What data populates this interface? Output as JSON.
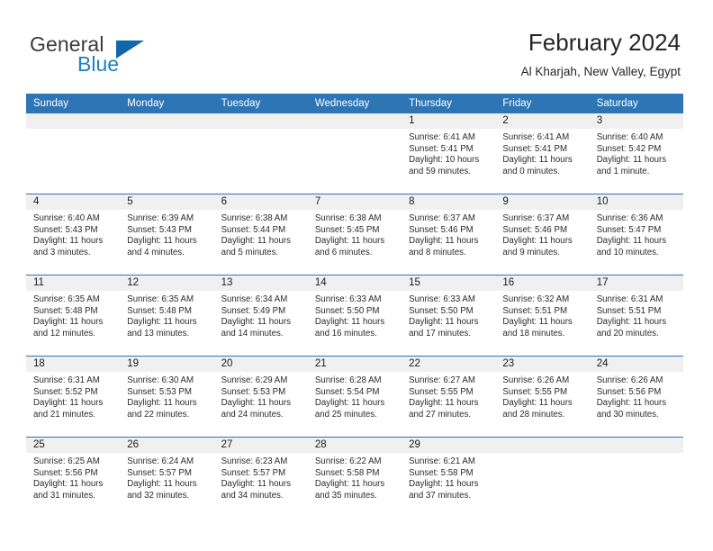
{
  "brand": {
    "name_part1": "General",
    "name_part2": "Blue",
    "triangle_icon": "triangle-logo-icon"
  },
  "header": {
    "title": "February 2024",
    "location": "Al Kharjah, New Valley, Egypt"
  },
  "colors": {
    "header_blue": "#2e75b6",
    "band_gray": "#f0f0f0",
    "brand_blue": "#1f7fc4",
    "text": "#262626"
  },
  "weekdays": [
    "Sunday",
    "Monday",
    "Tuesday",
    "Wednesday",
    "Thursday",
    "Friday",
    "Saturday"
  ],
  "weeks": [
    [
      {
        "day": "",
        "blank": true,
        "sunrise": "",
        "sunset": "",
        "daylight1": "",
        "daylight2": ""
      },
      {
        "day": "",
        "blank": true,
        "sunrise": "",
        "sunset": "",
        "daylight1": "",
        "daylight2": ""
      },
      {
        "day": "",
        "blank": true,
        "sunrise": "",
        "sunset": "",
        "daylight1": "",
        "daylight2": ""
      },
      {
        "day": "",
        "blank": true,
        "sunrise": "",
        "sunset": "",
        "daylight1": "",
        "daylight2": ""
      },
      {
        "day": "1",
        "blank": false,
        "sunrise": "Sunrise: 6:41 AM",
        "sunset": "Sunset: 5:41 PM",
        "daylight1": "Daylight: 10 hours",
        "daylight2": "and 59 minutes."
      },
      {
        "day": "2",
        "blank": false,
        "sunrise": "Sunrise: 6:41 AM",
        "sunset": "Sunset: 5:41 PM",
        "daylight1": "Daylight: 11 hours",
        "daylight2": "and 0 minutes."
      },
      {
        "day": "3",
        "blank": false,
        "sunrise": "Sunrise: 6:40 AM",
        "sunset": "Sunset: 5:42 PM",
        "daylight1": "Daylight: 11 hours",
        "daylight2": "and 1 minute."
      }
    ],
    [
      {
        "day": "4",
        "blank": false,
        "sunrise": "Sunrise: 6:40 AM",
        "sunset": "Sunset: 5:43 PM",
        "daylight1": "Daylight: 11 hours",
        "daylight2": "and 3 minutes."
      },
      {
        "day": "5",
        "blank": false,
        "sunrise": "Sunrise: 6:39 AM",
        "sunset": "Sunset: 5:43 PM",
        "daylight1": "Daylight: 11 hours",
        "daylight2": "and 4 minutes."
      },
      {
        "day": "6",
        "blank": false,
        "sunrise": "Sunrise: 6:38 AM",
        "sunset": "Sunset: 5:44 PM",
        "daylight1": "Daylight: 11 hours",
        "daylight2": "and 5 minutes."
      },
      {
        "day": "7",
        "blank": false,
        "sunrise": "Sunrise: 6:38 AM",
        "sunset": "Sunset: 5:45 PM",
        "daylight1": "Daylight: 11 hours",
        "daylight2": "and 6 minutes."
      },
      {
        "day": "8",
        "blank": false,
        "sunrise": "Sunrise: 6:37 AM",
        "sunset": "Sunset: 5:46 PM",
        "daylight1": "Daylight: 11 hours",
        "daylight2": "and 8 minutes."
      },
      {
        "day": "9",
        "blank": false,
        "sunrise": "Sunrise: 6:37 AM",
        "sunset": "Sunset: 5:46 PM",
        "daylight1": "Daylight: 11 hours",
        "daylight2": "and 9 minutes."
      },
      {
        "day": "10",
        "blank": false,
        "sunrise": "Sunrise: 6:36 AM",
        "sunset": "Sunset: 5:47 PM",
        "daylight1": "Daylight: 11 hours",
        "daylight2": "and 10 minutes."
      }
    ],
    [
      {
        "day": "11",
        "blank": false,
        "sunrise": "Sunrise: 6:35 AM",
        "sunset": "Sunset: 5:48 PM",
        "daylight1": "Daylight: 11 hours",
        "daylight2": "and 12 minutes."
      },
      {
        "day": "12",
        "blank": false,
        "sunrise": "Sunrise: 6:35 AM",
        "sunset": "Sunset: 5:48 PM",
        "daylight1": "Daylight: 11 hours",
        "daylight2": "and 13 minutes."
      },
      {
        "day": "13",
        "blank": false,
        "sunrise": "Sunrise: 6:34 AM",
        "sunset": "Sunset: 5:49 PM",
        "daylight1": "Daylight: 11 hours",
        "daylight2": "and 14 minutes."
      },
      {
        "day": "14",
        "blank": false,
        "sunrise": "Sunrise: 6:33 AM",
        "sunset": "Sunset: 5:50 PM",
        "daylight1": "Daylight: 11 hours",
        "daylight2": "and 16 minutes."
      },
      {
        "day": "15",
        "blank": false,
        "sunrise": "Sunrise: 6:33 AM",
        "sunset": "Sunset: 5:50 PM",
        "daylight1": "Daylight: 11 hours",
        "daylight2": "and 17 minutes."
      },
      {
        "day": "16",
        "blank": false,
        "sunrise": "Sunrise: 6:32 AM",
        "sunset": "Sunset: 5:51 PM",
        "daylight1": "Daylight: 11 hours",
        "daylight2": "and 18 minutes."
      },
      {
        "day": "17",
        "blank": false,
        "sunrise": "Sunrise: 6:31 AM",
        "sunset": "Sunset: 5:51 PM",
        "daylight1": "Daylight: 11 hours",
        "daylight2": "and 20 minutes."
      }
    ],
    [
      {
        "day": "18",
        "blank": false,
        "sunrise": "Sunrise: 6:31 AM",
        "sunset": "Sunset: 5:52 PM",
        "daylight1": "Daylight: 11 hours",
        "daylight2": "and 21 minutes."
      },
      {
        "day": "19",
        "blank": false,
        "sunrise": "Sunrise: 6:30 AM",
        "sunset": "Sunset: 5:53 PM",
        "daylight1": "Daylight: 11 hours",
        "daylight2": "and 22 minutes."
      },
      {
        "day": "20",
        "blank": false,
        "sunrise": "Sunrise: 6:29 AM",
        "sunset": "Sunset: 5:53 PM",
        "daylight1": "Daylight: 11 hours",
        "daylight2": "and 24 minutes."
      },
      {
        "day": "21",
        "blank": false,
        "sunrise": "Sunrise: 6:28 AM",
        "sunset": "Sunset: 5:54 PM",
        "daylight1": "Daylight: 11 hours",
        "daylight2": "and 25 minutes."
      },
      {
        "day": "22",
        "blank": false,
        "sunrise": "Sunrise: 6:27 AM",
        "sunset": "Sunset: 5:55 PM",
        "daylight1": "Daylight: 11 hours",
        "daylight2": "and 27 minutes."
      },
      {
        "day": "23",
        "blank": false,
        "sunrise": "Sunrise: 6:26 AM",
        "sunset": "Sunset: 5:55 PM",
        "daylight1": "Daylight: 11 hours",
        "daylight2": "and 28 minutes."
      },
      {
        "day": "24",
        "blank": false,
        "sunrise": "Sunrise: 6:26 AM",
        "sunset": "Sunset: 5:56 PM",
        "daylight1": "Daylight: 11 hours",
        "daylight2": "and 30 minutes."
      }
    ],
    [
      {
        "day": "25",
        "blank": false,
        "sunrise": "Sunrise: 6:25 AM",
        "sunset": "Sunset: 5:56 PM",
        "daylight1": "Daylight: 11 hours",
        "daylight2": "and 31 minutes."
      },
      {
        "day": "26",
        "blank": false,
        "sunrise": "Sunrise: 6:24 AM",
        "sunset": "Sunset: 5:57 PM",
        "daylight1": "Daylight: 11 hours",
        "daylight2": "and 32 minutes."
      },
      {
        "day": "27",
        "blank": false,
        "sunrise": "Sunrise: 6:23 AM",
        "sunset": "Sunset: 5:57 PM",
        "daylight1": "Daylight: 11 hours",
        "daylight2": "and 34 minutes."
      },
      {
        "day": "28",
        "blank": false,
        "sunrise": "Sunrise: 6:22 AM",
        "sunset": "Sunset: 5:58 PM",
        "daylight1": "Daylight: 11 hours",
        "daylight2": "and 35 minutes."
      },
      {
        "day": "29",
        "blank": false,
        "sunrise": "Sunrise: 6:21 AM",
        "sunset": "Sunset: 5:58 PM",
        "daylight1": "Daylight: 11 hours",
        "daylight2": "and 37 minutes."
      },
      {
        "day": "",
        "blank": true,
        "sunrise": "",
        "sunset": "",
        "daylight1": "",
        "daylight2": ""
      },
      {
        "day": "",
        "blank": true,
        "sunrise": "",
        "sunset": "",
        "daylight1": "",
        "daylight2": ""
      }
    ]
  ]
}
